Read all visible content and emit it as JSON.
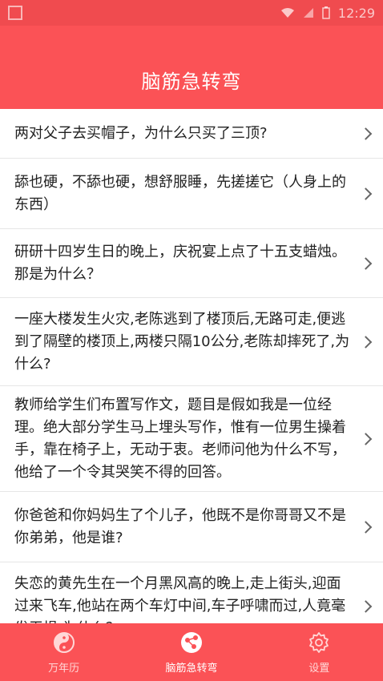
{
  "status_bar": {
    "time": "12:29"
  },
  "toolbar": {
    "title": "脑筋急转弯"
  },
  "questions": [
    "两对父子去买帽子，为什么只买了三顶?",
    "舔也硬，不舔也硬，想舒服睡，先搓搓它（人身上的东西）",
    "研研十四岁生日的晚上，庆祝宴上点了十五支蜡烛。那是为什么？",
    "一座大楼发生火灾,老陈逃到了楼顶后,无路可走,便逃到了隔壁的楼顶上,两楼只隔10公分,老陈却摔死了,为什么?",
    "教师给学生们布置写作文，题目是假如我是一位经理。绝大部分学生马上埋头写作，惟有一位男生操着手，靠在椅子上，无动于衷。老师问他为什么不写，他给了一个令其哭笑不得的回答。",
    "你爸爸和你妈妈生了个儿子，他既不是你哥哥又不是你弟弟，他是谁?",
    "失恋的黄先生在一个月黑风高的晚上,走上街头,迎面过来飞车,他站在两个车灯中间,车子呼啸而过,人竟毫发无损,为什么？"
  ],
  "tabs": [
    {
      "label": "万年历",
      "icon": "yin-yang-icon"
    },
    {
      "label": "脑筋急转弯",
      "icon": "share-nodes-icon"
    },
    {
      "label": "设置",
      "icon": "gear-icon"
    }
  ],
  "colors": {
    "primary": "#fb5256",
    "status_bar": "#f04b4f"
  }
}
